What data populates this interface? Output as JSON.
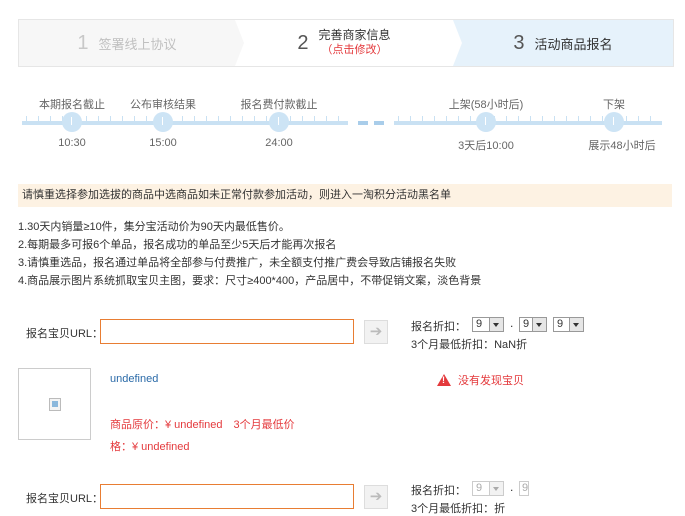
{
  "steps": [
    {
      "num": "1",
      "label": "签署线上协议"
    },
    {
      "num": "2",
      "label": "完善商家信息",
      "sub": "（点击修改）"
    },
    {
      "num": "3",
      "label": "活动商品报名"
    }
  ],
  "timeline": {
    "milestones": [
      {
        "label": "本期报名截止",
        "time": "10:30"
      },
      {
        "label": "公布审核结果",
        "time": "15:00"
      },
      {
        "label": "报名费付款截止",
        "time": "24:00"
      },
      {
        "label": "上架(58小时后)",
        "time": "3天后10:00"
      },
      {
        "label": "下架",
        "time": "展示48小时后"
      }
    ]
  },
  "notice": "请慎重选择参加选拔的商品中选商品如未正常付款参加活动，则进入一淘积分活动黑名单",
  "rules": [
    "1.30天内销量≥10件，集分宝活动价为90天内最低售价。",
    "2.每期最多可报6个单品，报名成功的单品至少5天后才能再次报名",
    "3.请慎重选品，报名通过单品将全部参与付费推广，未全额支付推广费会导致店铺报名失败",
    "4.商品展示图片系统抓取宝贝主图，要求：尺寸≥400*400，产品居中，不带促销文案，淡色背景"
  ],
  "form1": {
    "url_label": "报名宝贝URL：",
    "url_value": "",
    "go_icon": "arrow-right-icon",
    "discount_label": "报名折扣：",
    "discount_digits": [
      "9",
      "9",
      "9"
    ],
    "lowest_label": "3个月最低折扣：NaN折"
  },
  "product": {
    "name": "undefined",
    "price_line1": "商品原价：¥ undefined　3个月最低价",
    "price_line2": "格：¥ undefined",
    "warning": "没有发现宝贝"
  },
  "form2": {
    "url_label": "报名宝贝URL：",
    "url_value": "",
    "discount_label": "报名折扣：",
    "discount_digits": [
      "9",
      "9"
    ],
    "lowest_label": "3个月最低折扣：折"
  },
  "colors": {
    "accent_blue": "#c9e1f3",
    "alert_red": "#e4393c",
    "input_border": "#e87d33",
    "notice_bg": "#fdf2e3"
  }
}
